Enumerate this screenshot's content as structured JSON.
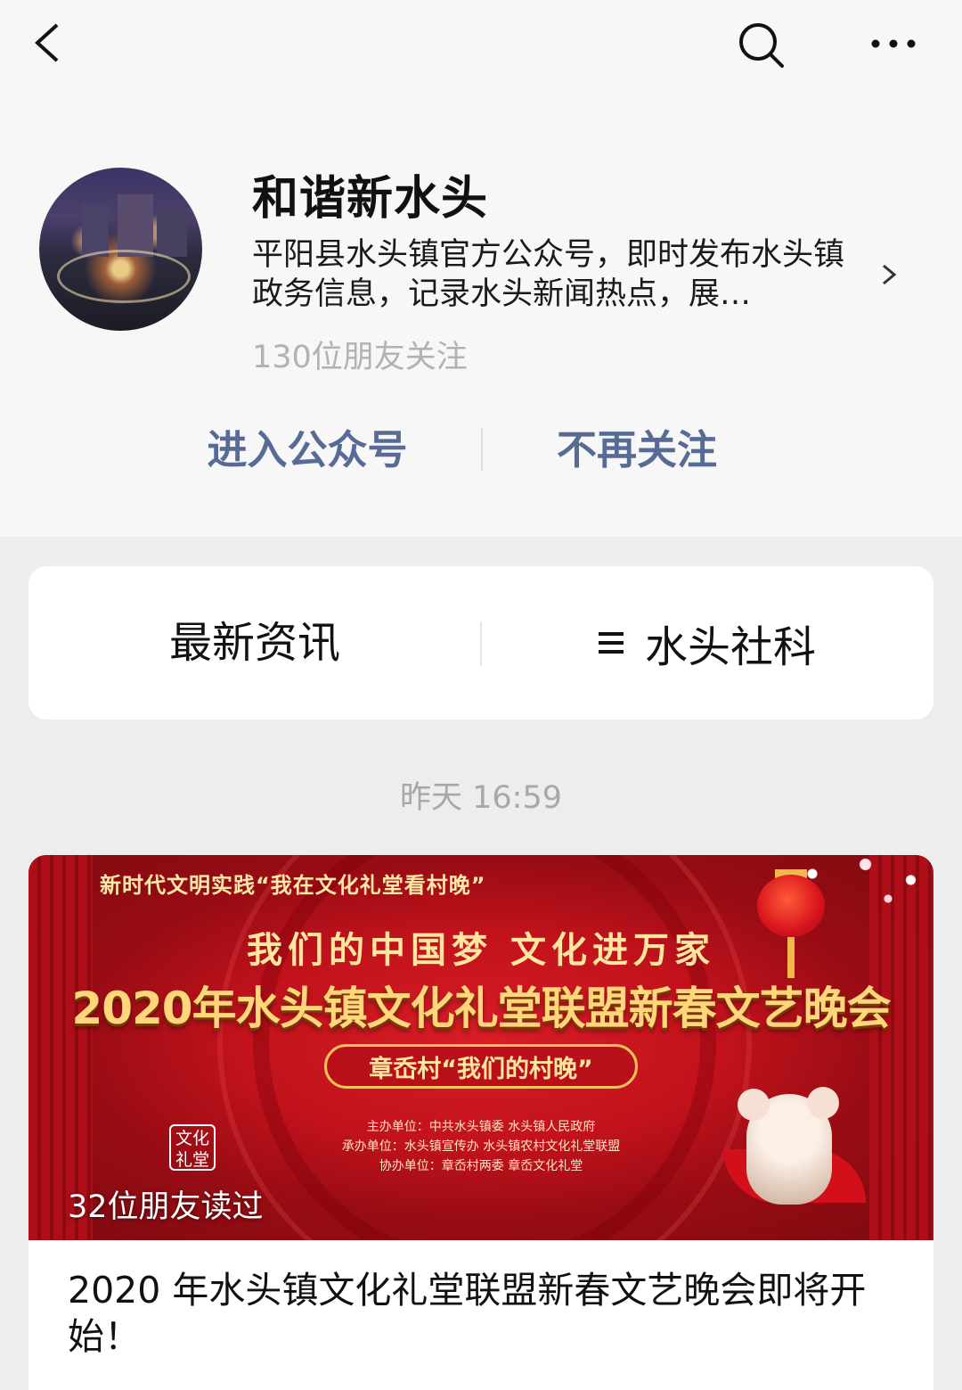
{
  "nav": {
    "back_icon": "chevron-left-icon",
    "search_icon": "search-icon",
    "more_icon": "more-dots-icon"
  },
  "account": {
    "name": "和谐新水头",
    "description": "平阳县水头镇官方公众号，即时发布水头镇政务信息，记录水头新闻热点，展…",
    "followers": "130位朋友关注"
  },
  "actions": {
    "enter": "进入公众号",
    "unfollow": "不再关注"
  },
  "menu": {
    "left": "最新资讯",
    "right": "水头社科",
    "right_icon": "menu-lines-icon"
  },
  "feed": {
    "time": "昨天 16:59",
    "article": {
      "cover": {
        "top_line": "新时代文明实践“我在文化礼堂看村晚”",
        "slogan": "我们的中国梦  文化进万家",
        "title": "2020年水头镇文化礼堂联盟新春文艺晚会",
        "sub": "章岙村“我们的村晚”",
        "org_1": "主办单位：中共水头镇委  水头镇人民政府",
        "org_2": "承办单位：水头镇宣传办  水头镇农村文化礼堂联盟",
        "org_3": "协办单位：章岙村两委  章岙文化礼堂",
        "seal": "文化\n礼堂",
        "read_count": "32位朋友读过"
      },
      "title": "2020 年水头镇文化礼堂联盟新春文艺晚会即将开始！"
    }
  },
  "colors": {
    "link_blue": "#576b95",
    "muted_gray": "#b2b2b2",
    "cover_red": "#c1121c",
    "gold": "#ffd67a"
  }
}
